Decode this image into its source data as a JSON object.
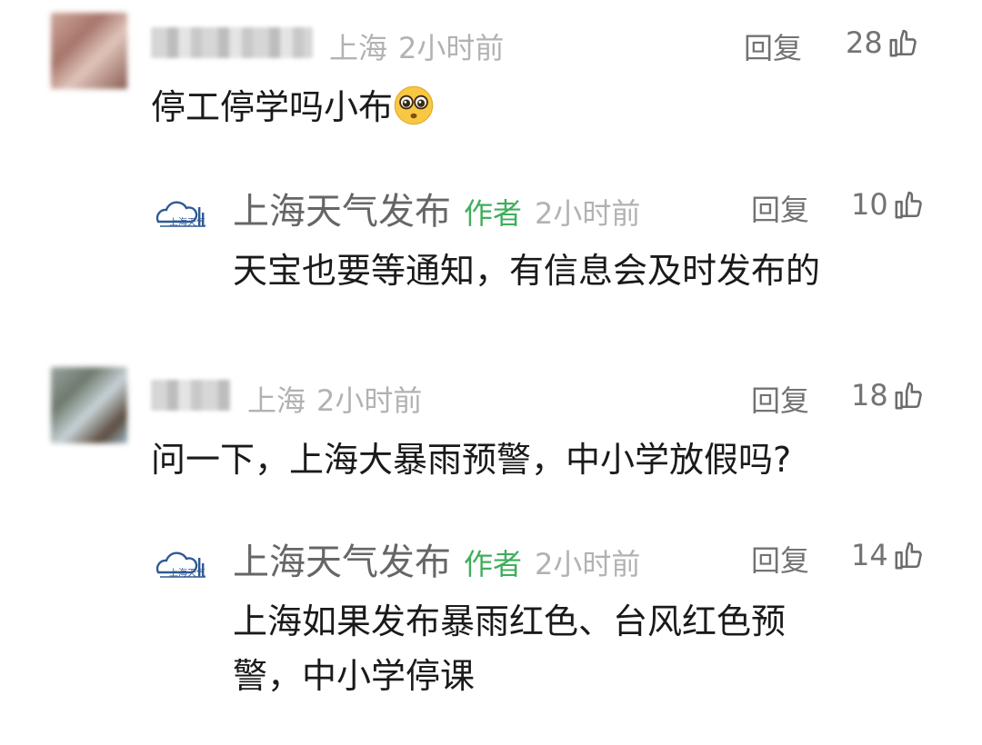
{
  "comments": [
    {
      "location": "上海",
      "time": "2小时前",
      "reply_label": "回复",
      "likes": "28",
      "text": "停工停学吗小布",
      "emoji": "pleading-face-emoji",
      "reply": {
        "author": "上海天气发布",
        "author_tag": "作者",
        "time": "2小时前",
        "reply_label": "回复",
        "likes": "10",
        "logo_text": "上海天气",
        "text": "天宝也要等通知，有信息会及时发布的"
      }
    },
    {
      "location": "上海",
      "time": "2小时前",
      "reply_label": "回复",
      "likes": "18",
      "text": "问一下，上海大暴雨预警，中小学放假吗?",
      "reply": {
        "author": "上海天气发布",
        "author_tag": "作者",
        "time": "2小时前",
        "reply_label": "回复",
        "likes": "14",
        "logo_text": "上海天气",
        "text_line1": "上海如果发布暴雨红色、台风红色预",
        "text_line2": "警，中小学停课"
      }
    }
  ],
  "colors": {
    "author_tag": "#3fae5c",
    "meta": "#b2b2b2",
    "text": "#1a1a1a",
    "logo": "#2f5a93"
  },
  "icons": [
    "thumbs-up-icon",
    "pleading-face-emoji",
    "shanghai-weather-logo"
  ]
}
